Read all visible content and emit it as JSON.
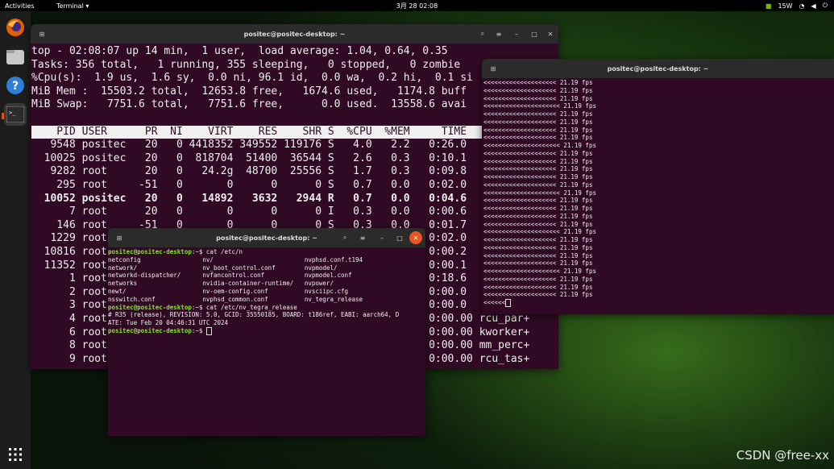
{
  "panel": {
    "activities": "Activities",
    "app_menu": "Terminal ▾",
    "clock": "3月 28 02:08",
    "power": "15W",
    "tray_icons": [
      "nvidia-icon",
      "wifi-icon",
      "volume-icon",
      "power-icon"
    ]
  },
  "dock": {
    "items": [
      {
        "name": "firefox",
        "icon": "firefox-icon"
      },
      {
        "name": "files",
        "icon": "files-icon"
      },
      {
        "name": "help",
        "icon": "help-icon"
      },
      {
        "name": "terminal",
        "icon": "terminal-icon"
      }
    ],
    "show_apps_icon": "grid-icon"
  },
  "win_top": {
    "title": "positec@positec-desktop: ~",
    "summary": [
      "top - 02:08:07 up 14 min,  1 user,  load average: 1.04, 0.64, 0.35",
      "Tasks: 356 total,   1 running, 355 sleeping,   0 stopped,   0 zombie",
      "%Cpu(s):  1.9 us,  1.6 sy,  0.0 ni, 96.1 id,  0.0 wa,  0.2 hi,  0.1 si",
      "MiB Mem :  15503.2 total,  12653.8 free,   1674.6 used,   1174.8 buff",
      "MiB Swap:   7751.6 total,   7751.6 free,      0.0 used.  13558.6 avai"
    ],
    "header": "    PID USER      PR  NI    VIRT    RES    SHR S  %CPU  %MEM     TIME",
    "rows": [
      "   9548 positec   20   0 4418352 349552 119176 S   4.0   2.2   0:26.0",
      "  10025 positec   20   0  818704  51400  36544 S   2.6   0.3   0:10.1",
      "   9282 root      20   0   24.2g  48700  25556 S   1.7   0.3   0:09.8",
      "    295 root     -51   0       0      0      0 S   0.7   0.0   0:02.0",
      "  10052 positec   20   0   14892   3632   2944 R   0.7   0.0   0:04.6",
      "      7 root      20   0       0      0      0 I   0.3   0.0   0:00.6",
      "    146 root     -51   0       0      0      0 S   0.3   0.0   0:01.7",
      "   1229 root      20   0       0      0      0 S   0.3   0.0   0:02.0",
      "  10816 root      20   0       0      0      0 I   0.3   0.0   0:00.2",
      "  11352 root      20   0       0      0      0 I   0.3   0.0   0:00.1",
      "      1 root      20   0       0      0      0 S   0.0   0.0   0:18.6",
      "      2 root      20   0       0      0      0 S   0.0   0.0   0:00.0",
      "      3 root      20   0       0      0      0 I   0.0   0.0   0:00.0",
      "      4 root      20   0       0      0      0 I   0.0   0.0   0:00.00 rcu_par+",
      "      6 root      20   0       0      0      0 I   0.0   0.0   0:00.00 kworker+",
      "      8 root      20   0       0      0      0 I   0.0   0.0   0:00.00 mm_perc+",
      "      9 root      20   0       0      0      0 S   0.0   0.0   0:00.00 rcu_tas+"
    ],
    "bold_row_index": 4
  },
  "win_fps": {
    "title": "positec@positec-desktop: ~",
    "lines": [
      "<<<<<<<<<<<<<<<<<<<< 21.19 fps",
      "<<<<<<<<<<<<<<<<<<<< 21.19 fps",
      "<<<<<<<<<<<<<<<<<<<< 21.19 fps",
      "<<<<<<<<<<<<<<<<<<<<< 21.19 fps",
      "<<<<<<<<<<<<<<<<<<<< 21.19 fps",
      "<<<<<<<<<<<<<<<<<<<< 21.19 fps",
      "<<<<<<<<<<<<<<<<<<<< 21.19 fps",
      "<<<<<<<<<<<<<<<<<<<< 21.19 fps",
      "<<<<<<<<<<<<<<<<<<<<< 21.19 fps",
      "<<<<<<<<<<<<<<<<<<<< 21.19 fps",
      "<<<<<<<<<<<<<<<<<<<< 21.19 fps",
      "<<<<<<<<<<<<<<<<<<<< 21.19 fps",
      "<<<<<<<<<<<<<<<<<<<< 21.19 fps",
      "<<<<<<<<<<<<<<<<<<<< 21.19 fps",
      "<<<<<<<<<<<<<<<<<<<<< 21.19 fps",
      "<<<<<<<<<<<<<<<<<<<< 21.19 fps",
      "<<<<<<<<<<<<<<<<<<<< 21.19 fps",
      "<<<<<<<<<<<<<<<<<<<< 21.19 fps",
      "<<<<<<<<<<<<<<<<<<<< 21.19 fps",
      "<<<<<<<<<<<<<<<<<<<<< 21.19 fps",
      "<<<<<<<<<<<<<<<<<<<< 21.19 fps",
      "<<<<<<<<<<<<<<<<<<<< 21.19 fps",
      "<<<<<<<<<<<<<<<<<<<< 21.19 fps",
      "<<<<<<<<<<<<<<<<<<<< 21.19 fps",
      "<<<<<<<<<<<<<<<<<<<<< 21.19 fps",
      "<<<<<<<<<<<<<<<<<<<< 21.19 fps",
      "<<<<<<<<<<<<<<<<<<<< 21.19 fps",
      "<<<<<<<<<<<<<<<<<<<< 21.19 fps",
      "<<<<<<"
    ]
  },
  "win_cat": {
    "title": "positec@positec-desktop: ~",
    "prompt_user": "positec@positec-desktop",
    "lines": [
      {
        "prompt": true,
        "cmd": ":~$ cat /etc/n"
      },
      {
        "text": "netconfig                 nv/                         nvphsd.conf.t194"
      },
      {
        "text": "network/                  nv_boot_control.conf        nvpmodel/"
      },
      {
        "text": "networkd-dispatcher/      nvfancontrol.conf           nvpmodel.conf"
      },
      {
        "text": "networks                  nvidia-container-runtime/   nvpower/"
      },
      {
        "text": "newt/                     nv-oem-config.conf          nvsciipc.cfg"
      },
      {
        "text": "nsswitch.conf             nvphsd_common.conf          nv_tegra_release"
      },
      {
        "prompt": true,
        "cmd": ":~$ cat /etc/nv_tegra_release"
      },
      {
        "text": "# R35 (release), REVISION: 5.0, GCID: 35550185, BOARD: t186ref, EABI: aarch64, D"
      },
      {
        "text": "ATE: Tue Feb 20 04:46:31 UTC 2024"
      },
      {
        "prompt": true,
        "cmd": ":~$ "
      }
    ]
  },
  "watermark": "CSDN @free-xx"
}
